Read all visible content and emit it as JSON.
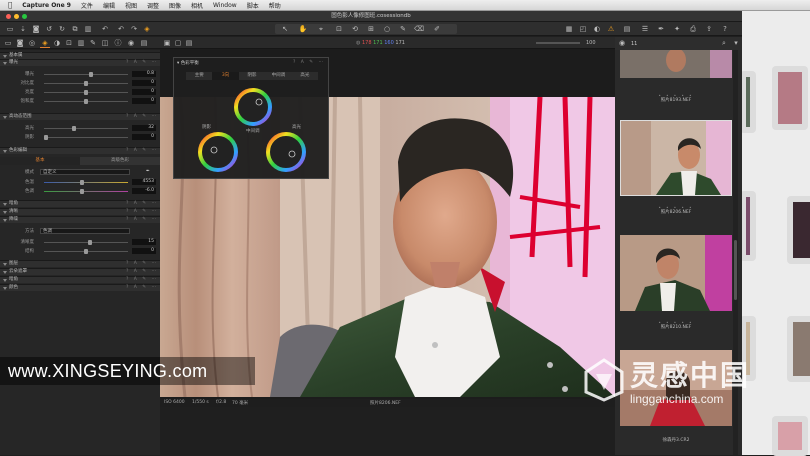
{
  "menubar": {
    "apple": "",
    "app": "Capture One 9",
    "items": [
      "文件",
      "编辑",
      "视图",
      "调整",
      "图像",
      "相机",
      "Window",
      "脚本",
      "帮助"
    ]
  },
  "window_title": "固色影人像修图班.cosessiondb",
  "viewer_toolbar": {
    "color_readout": [
      "178",
      "171",
      "160",
      "171"
    ],
    "zoom": "100"
  },
  "browser_toolbar": {
    "count": "11"
  },
  "left_panel": {
    "sections": {
      "basic": "基本属",
      "exposure": "曝光",
      "hdr": "高动态范围",
      "color_editor": "色彩编辑",
      "vignette": "暗角",
      "clarity": "清晰",
      "noise": "降噪",
      "levels": "色阶",
      "curve": "曲线",
      "sharpen": "锐化",
      "moire": "波纹",
      "vignetting": "暗角",
      "lens": "镜头",
      "black_white": "黑白",
      "extra1": "图像",
      "extra2": "颜色平衡",
      "extra3": "色调"
    },
    "exposure_rows": [
      {
        "label": "曝光",
        "value": "0.8"
      },
      {
        "label": "对比度",
        "value": "0"
      },
      {
        "label": "亮度",
        "value": "0"
      },
      {
        "label": "饱和度",
        "value": "0"
      }
    ],
    "hdr_rows": [
      {
        "label": "高光",
        "value": "32"
      },
      {
        "label": "阴影",
        "value": "0"
      }
    ],
    "color_tabs": [
      "基本",
      "高级色彩"
    ],
    "color_mode_label": "模式",
    "color_mode_value": "自定义",
    "color_rows": [
      {
        "label": "色温",
        "value": "4553"
      },
      {
        "label": "色调",
        "value": "-6.0"
      }
    ],
    "vignette_method_label": "方法",
    "vignette_method_value": "色调",
    "vignette_rows": [
      {
        "label": "清晰度",
        "value": "15"
      },
      {
        "label": "结构",
        "value": "0"
      }
    ],
    "lower_sections": [
      "图层",
      "云朵遮罩",
      "暗角",
      "颜色",
      "预览"
    ]
  },
  "color_balance": {
    "title": "色彩平衡",
    "tabs": [
      "主要",
      "3向",
      "阴影",
      "中间调",
      "高光"
    ],
    "wheel_labels": [
      "阴影",
      "中间调",
      "高光"
    ]
  },
  "info_bar": {
    "iso": "ISO 6400",
    "shutter": "1/550 s",
    "aperture": "f/2.8",
    "focal": "70 毫米",
    "filename": "照片8206.NEF"
  },
  "thumbnails": [
    {
      "caption": "照片8193.NEF"
    },
    {
      "caption": "照片8206.NEF"
    },
    {
      "caption": "照片8210.NEF"
    },
    {
      "caption": "徐森丹3.CR2"
    }
  ],
  "watermark": "www.XINGSEYING.com",
  "logo": {
    "main": "灵感中国",
    "sub": "lingganchina.com"
  },
  "colors": {
    "accent": "#e08030",
    "warning": "#f0a020",
    "panel": "#262626"
  }
}
